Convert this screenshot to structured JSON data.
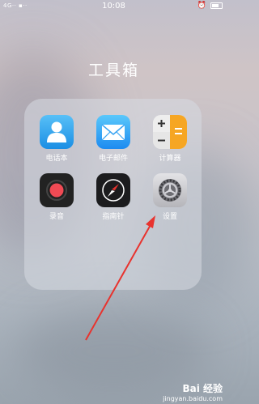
{
  "status_bar": {
    "left": "4G·· ▪··",
    "time": "10:08",
    "right_icons": "⏰ ⬥"
  },
  "folder": {
    "title": "工具箱",
    "apps": [
      {
        "label": "电话本",
        "icon": "contacts-icon"
      },
      {
        "label": "电子邮件",
        "icon": "mail-icon"
      },
      {
        "label": "计算器",
        "icon": "calculator-icon"
      },
      {
        "label": "录音",
        "icon": "recorder-icon"
      },
      {
        "label": "指南针",
        "icon": "compass-icon"
      },
      {
        "label": "设置",
        "icon": "settings-gear-icon"
      }
    ]
  },
  "annotation": {
    "arrow_color": "#e8332e"
  },
  "watermark": {
    "brand": "Bai 经验",
    "url": "jingyan.baidu.com"
  }
}
